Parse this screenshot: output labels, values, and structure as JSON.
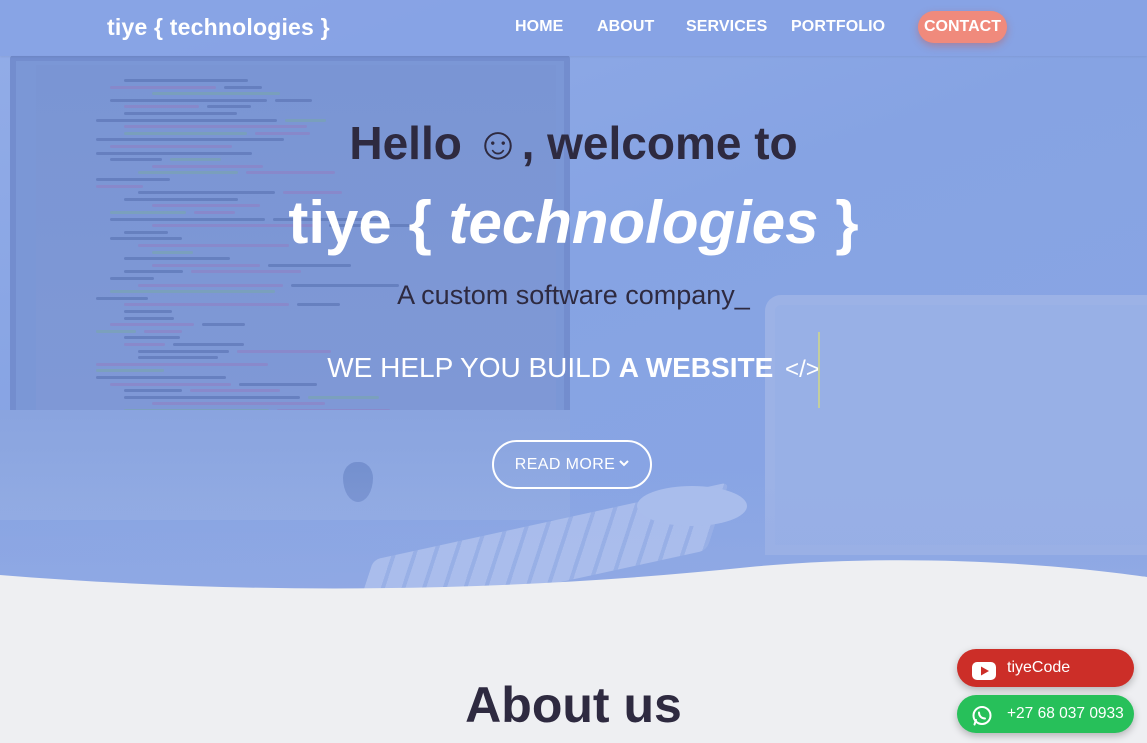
{
  "navbar": {
    "brand": "tiye { technologies }",
    "links": [
      {
        "label": "HOME"
      },
      {
        "label": "ABOUT"
      },
      {
        "label": "SERVICES"
      },
      {
        "label": "PORTFOLIO"
      }
    ],
    "contact_label": "CONTACT"
  },
  "hero": {
    "hello": "Hello ☺, welcome to",
    "brand_prefix": "tiye { ",
    "brand_accent": "technologies",
    "brand_suffix": " }",
    "tagline": "A custom software company_",
    "typed_prefix": "WE HELP YOU BUILD ",
    "typed_bold": "A WEBSITE",
    "typed_icon": "</>",
    "read_more_label": "READ MORE",
    "read_more_icon": "chevron-down-icon"
  },
  "about": {
    "title": "About us"
  },
  "floating": {
    "youtube_label": "tiyeCode",
    "youtube_icon": "youtube-icon",
    "youtube_color": "#cc2e28",
    "whatsapp_label": "+27 68 037 0933",
    "whatsapp_icon": "whatsapp-icon",
    "whatsapp_color": "#27c05a"
  },
  "colors": {
    "hero_overlay": "#87a3e4",
    "contact_button": "#f08a7c",
    "heading_dark": "#2e2a40",
    "page_background": "#eeeff2"
  }
}
